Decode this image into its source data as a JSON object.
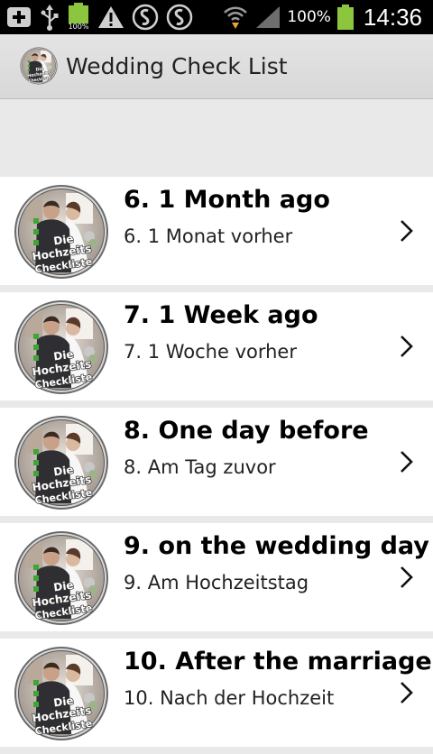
{
  "status_bar": {
    "small_battery_label": "100%",
    "battery_percent": "100%",
    "time": "14:36",
    "icons": [
      "add-icon",
      "usb-icon",
      "battery-small-icon",
      "warning-icon",
      "shazam-icon",
      "shazam-icon",
      "wifi-icon",
      "signal-icon",
      "battery-icon"
    ]
  },
  "app_bar": {
    "title": "Wedding Check List",
    "logo_text_1": "Die",
    "logo_text_2": "Hochzeits",
    "logo_text_3": "Checkliste"
  },
  "list": {
    "items": [
      {
        "title": "6. 1 Month ago",
        "subtitle": "6. 1 Monat vorher"
      },
      {
        "title": "7. 1 Week ago",
        "subtitle": "7. 1 Woche vorher"
      },
      {
        "title": "8. One day before",
        "subtitle": "8. Am Tag zuvor"
      },
      {
        "title": "9. on the wedding day",
        "subtitle": "9. Am Hochzeitstag"
      },
      {
        "title": "10. After the marriage",
        "subtitle": "10. Nach der Hochzeit"
      }
    ]
  },
  "colors": {
    "status_bar_bg": "#000000",
    "action_bar_bg": "#dcdcdc",
    "list_bg": "#ffffff",
    "separator_bg": "#e9e9e9",
    "battery_green": "#8cc63f"
  }
}
